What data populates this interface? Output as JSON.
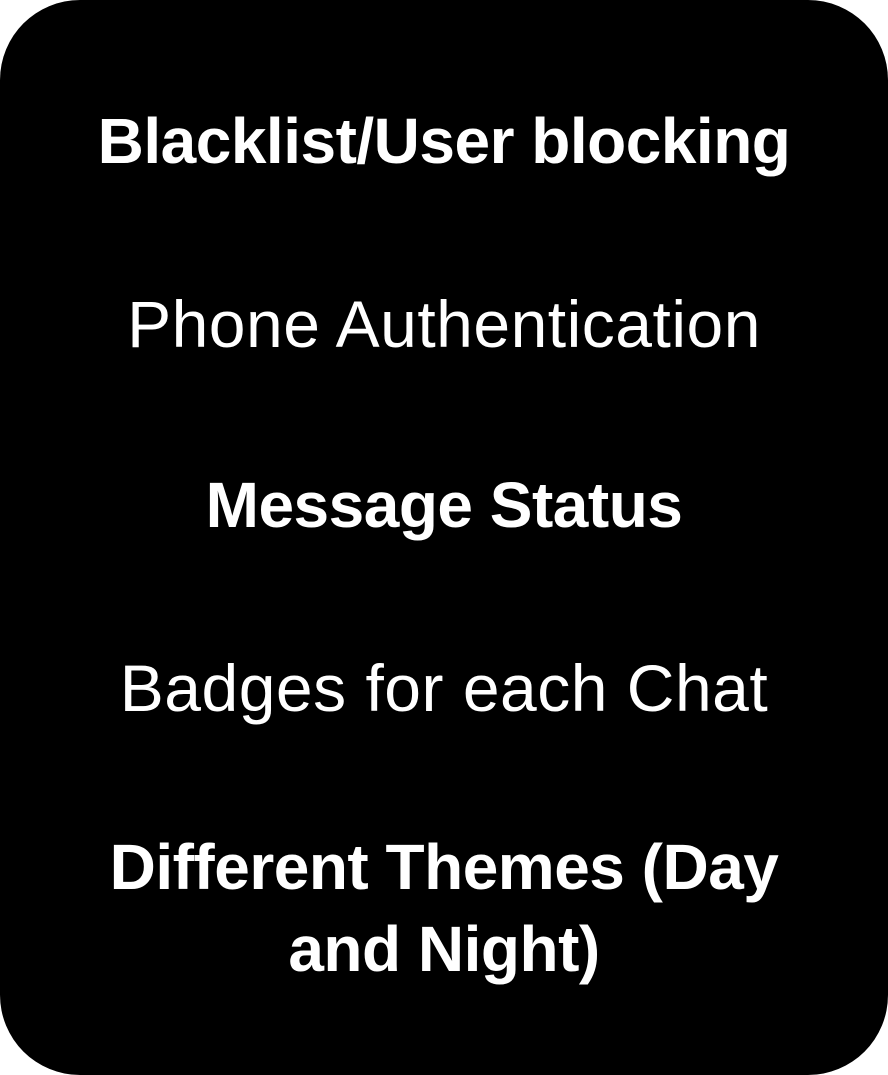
{
  "features": [
    "Blacklist/User blocking",
    "Phone Authentication",
    "Message Status",
    "Badges for each Chat",
    "Different Themes (Day and Night)"
  ],
  "colors": {
    "background": "#000000",
    "text": "#ffffff"
  }
}
